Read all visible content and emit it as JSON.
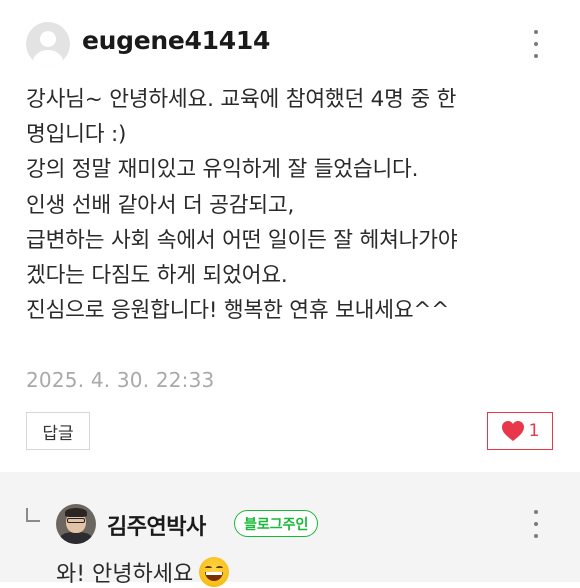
{
  "comment": {
    "username": "eugene41414",
    "lines": [
      "강사님~ 안녕하세요. 교육에 참여했던 4명 중 한",
      "명입니다 :)",
      "강의 정말 재미있고 유익하게 잘 들었습니다.",
      "인생 선배 같아서 더 공감되고,",
      "급변하는 사회 속에서 어떤 일이든 잘 헤쳐나가야",
      "겠다는 다짐도 하게 되었어요.",
      "진심으로 응원합니다! 행복한 연휴 보내세요^^"
    ],
    "date": "2025. 4. 30. 22:33",
    "reply_label": "답글",
    "like_count": "1",
    "icons": {
      "avatar": "default-user-avatar-icon",
      "more": "more-vertical-icon",
      "like": "heart-icon"
    }
  },
  "reply": {
    "author": "김주연박사",
    "badge": "블로그주인",
    "text": "와! 안녕하세요",
    "emoji": "grinning-face-icon"
  },
  "colors": {
    "like_accent": "#e8364a",
    "badge_green": "#19b839",
    "date_gray": "#a9a9a9",
    "reply_bg": "#f4f4f4"
  }
}
